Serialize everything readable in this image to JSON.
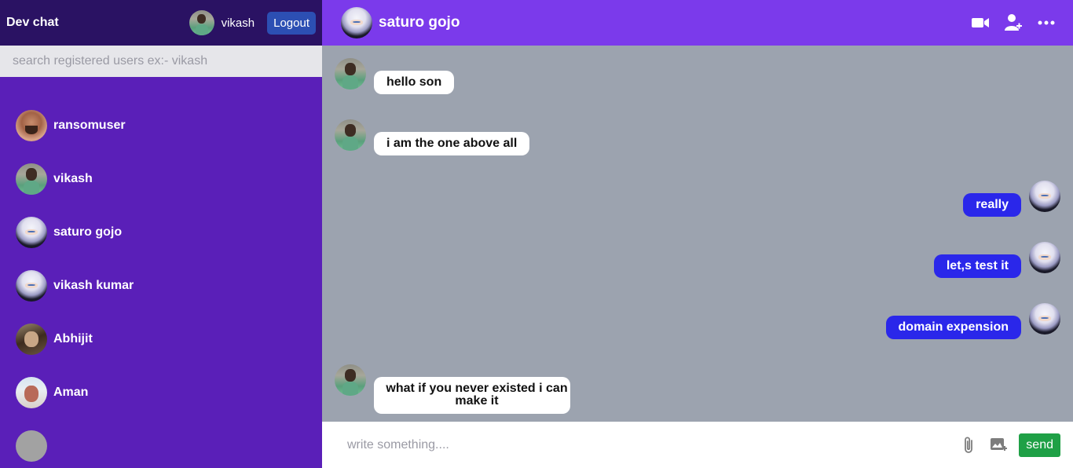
{
  "app": {
    "title": "Dev chat"
  },
  "current_user": {
    "name": "vikash",
    "logout_label": "Logout"
  },
  "search": {
    "placeholder": "search registered users ex:- vikash",
    "value": ""
  },
  "users": [
    {
      "name": "ransomuser",
      "avatar": "ransom-avatar"
    },
    {
      "name": "vikash",
      "avatar": "person-avatar"
    },
    {
      "name": "saturo gojo",
      "avatar": "gojo-avatar"
    },
    {
      "name": "vikash kumar",
      "avatar": "gojo-avatar"
    },
    {
      "name": "Abhijit",
      "avatar": "abhijit-avatar"
    },
    {
      "name": "Aman",
      "avatar": "aman-avatar"
    }
  ],
  "chat": {
    "contact_name": "saturo gojo",
    "header_icons": [
      "video-call-icon",
      "add-user-icon",
      "more-options-icon"
    ],
    "messages": [
      {
        "side": "left",
        "text": "hello son"
      },
      {
        "side": "left",
        "text": "i am the one above all"
      },
      {
        "side": "right",
        "text": "really"
      },
      {
        "side": "right",
        "text": "let,s test it"
      },
      {
        "side": "right",
        "text": "domain expension"
      },
      {
        "side": "left",
        "text": "what if you never existed i can make it"
      }
    ],
    "composer": {
      "placeholder": "write something....",
      "value": "",
      "send_label": "send"
    }
  },
  "colors": {
    "sidebar": "#5a1fb8",
    "topbar": "#2a1263",
    "chat_header": "#7b3aeb",
    "chat_bg": "#9ca3af",
    "sent_bubble": "#2a27ea",
    "send_button": "#1fa046",
    "logout_button": "#2c4fb3"
  }
}
